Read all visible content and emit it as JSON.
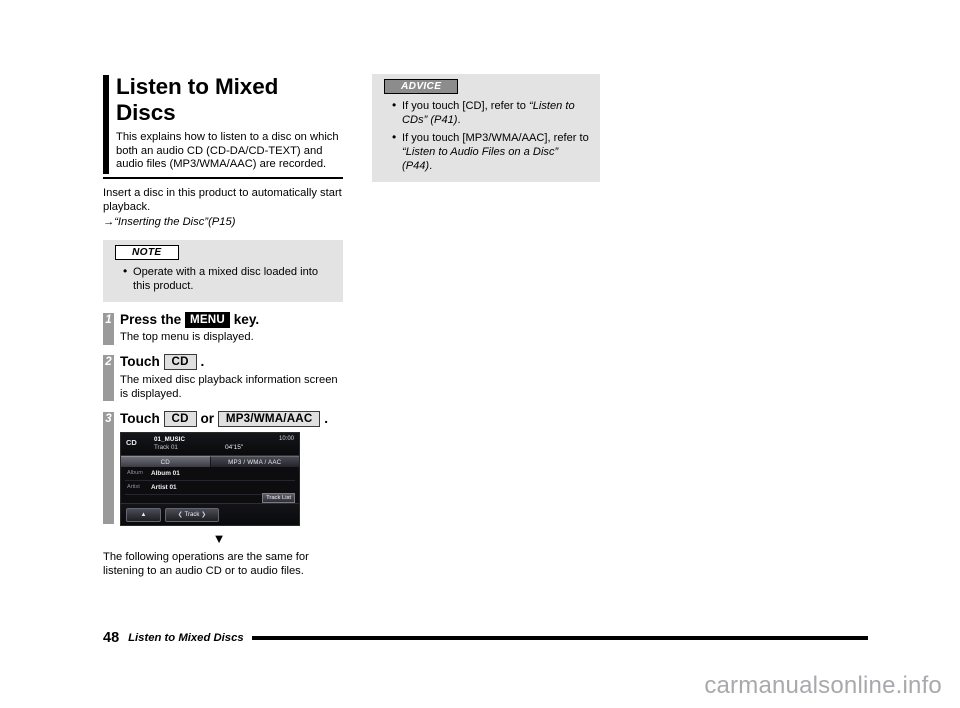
{
  "document": {
    "title": "Listen to Mixed Discs",
    "title_line1": "Listen to Mixed",
    "title_line2": "Discs",
    "intro": "This explains how to listen to a disc on which both an audio CD (CD-DA/CD-TEXT) and audio files (MP3/WMA/AAC) are recorded.",
    "body_para": "Insert a disc in this product to automatically start playback.",
    "cross_reference": "→“Inserting the Disc”(P15)",
    "closing_para": "The following operations are the same for listening to an audio CD or to audio files."
  },
  "note_box": {
    "tab_label": "NOTE",
    "items": [
      "Operate with a mixed disc loaded into this product."
    ]
  },
  "advice_box": {
    "tab_label": "ADVICE",
    "items": [
      {
        "lead": "If you touch [CD], refer to ",
        "emphasis": "“Listen to CDs” (P41)",
        "tail": "."
      },
      {
        "lead": "If you touch [MP3/WMA/AAC], refer to ",
        "emphasis": "“Listen to Audio Files on a Disc” (P44)",
        "tail": "."
      }
    ]
  },
  "steps": [
    {
      "number": "1",
      "title_pre": "Press the ",
      "key": "MENU",
      "key_style": "dark",
      "title_post": " key.",
      "body": "The top menu is displayed."
    },
    {
      "number": "2",
      "title_pre": "Touch ",
      "key": "CD",
      "key_style": "light",
      "title_post": " .",
      "body": "The mixed disc playback information screen is displayed."
    },
    {
      "number": "3",
      "title_pre": "Touch ",
      "key": "CD",
      "key_style": "light",
      "conjunction": " or ",
      "key2": "MP3/WMA/AAC",
      "title_post": " .",
      "body": ""
    }
  ],
  "device_screen": {
    "source_label": "CD",
    "track_title": "01_MUSIC",
    "track_number": "Track 01",
    "elapsed_time": "04'15\"",
    "clock": "10:00",
    "tab_cd": "CD",
    "tab_files": "MP3 / WMA / AAC",
    "album_label": "Album",
    "album_value": "Album 01",
    "artist_label": "Artist",
    "artist_value": "Artist 01",
    "track_list_button": "Track List",
    "eject_icon": "▲",
    "track_prev_icon": "❮",
    "track_button_label": "Track",
    "track_next_icon": "❯"
  },
  "flow_arrow": "▼",
  "footer": {
    "page_number": "48",
    "section_title": "Listen to Mixed Discs"
  },
  "watermark": "carmanualsonline.info",
  "colors": {
    "callout_bg": "#e3e3e3",
    "advice_tab_bg": "#8c8c8c",
    "step_bar": "#9a9a9a",
    "key_dark_bg": "#000000",
    "key_light_bg": "#e0e0e0",
    "watermark": "#a9a9ad"
  }
}
